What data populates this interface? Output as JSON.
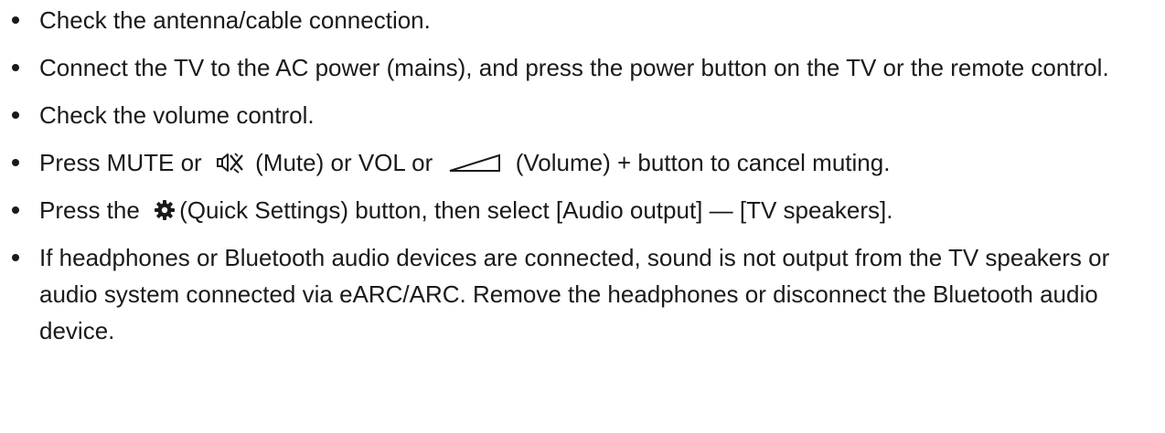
{
  "items": [
    {
      "text": "Check the antenna/cable connection."
    },
    {
      "text": "Connect the TV to the AC power (mains), and press the power button on the TV or the remote control."
    },
    {
      "text": "Check the volume control."
    },
    {
      "a": "Press MUTE or ",
      "mute_icon": "mute-icon",
      "b": " (Mute) or VOL or ",
      "volume_icon": "volume-icon",
      "c": " (Volume) + button to cancel muting."
    },
    {
      "a": "Press the ",
      "settings_icon": "gear-icon",
      "b": "(Quick Settings) button, then select [Audio output] — [TV speakers]."
    },
    {
      "text": "If headphones or Bluetooth audio devices are connected, sound is not output from the TV speakers or audio system connected via eARC/ARC. Remove the headphones or disconnect the Bluetooth audio device."
    }
  ]
}
